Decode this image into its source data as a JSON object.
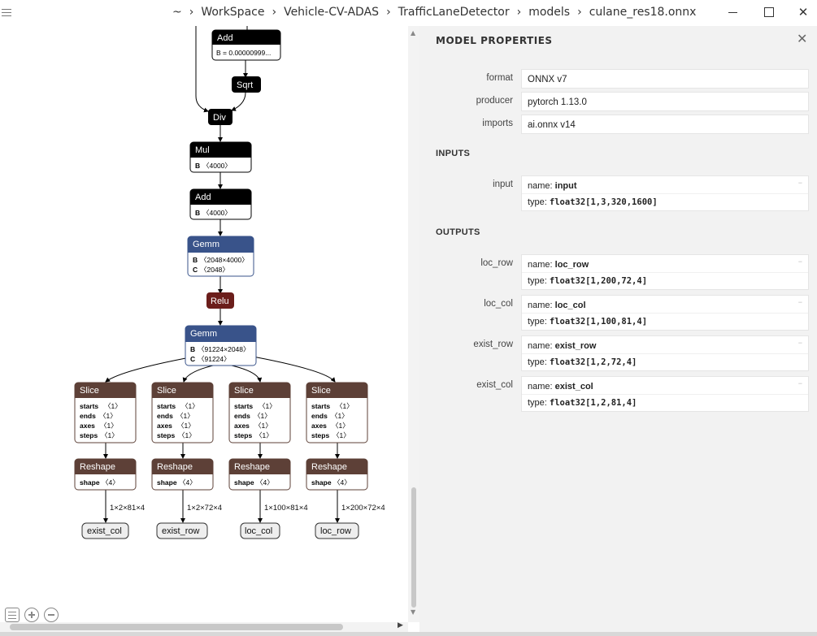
{
  "breadcrumb": [
    "~",
    "WorkSpace",
    "Vehicle-CV-ADAS",
    "TrafficLaneDetector",
    "models",
    "culane_res18.onnx"
  ],
  "window": {
    "minimize": "—",
    "maximize": "☐",
    "close": "✕"
  },
  "graph": {
    "nodes": {
      "add_top": {
        "op": "Add",
        "attr_label": "B = 0.00000999..."
      },
      "sqrt": {
        "op": "Sqrt"
      },
      "div": {
        "op": "Div"
      },
      "mul": {
        "op": "Mul",
        "attr_key": "B",
        "attr_val": "〈4000〉"
      },
      "add2": {
        "op": "Add",
        "attr_key": "B",
        "attr_val": "〈4000〉"
      },
      "gemm1": {
        "op": "Gemm",
        "b_key": "B",
        "b_val": "〈2048×4000〉",
        "c_key": "C",
        "c_val": "〈2048〉"
      },
      "relu": {
        "op": "Relu"
      },
      "gemm2": {
        "op": "Gemm",
        "b_key": "B",
        "b_val": "〈91224×2048〉",
        "c_key": "C",
        "c_val": "〈91224〉"
      }
    },
    "slice": {
      "op": "Slice",
      "keys": [
        "starts",
        "ends",
        "axes",
        "steps"
      ],
      "val": "〈1〉"
    },
    "reshape": {
      "op": "Reshape",
      "key": "shape",
      "val": "〈4〉"
    },
    "branches": [
      {
        "shape": "1×2×81×4",
        "output": "exist_col"
      },
      {
        "shape": "1×2×72×4",
        "output": "exist_row"
      },
      {
        "shape": "1×100×81×4",
        "output": "loc_col"
      },
      {
        "shape": "1×200×72×4",
        "output": "loc_row"
      }
    ]
  },
  "panel": {
    "title": "MODEL PROPERTIES",
    "close": "✕",
    "properties": [
      {
        "label": "format",
        "value": "ONNX v7"
      },
      {
        "label": "producer",
        "value": "pytorch 1.13.0"
      },
      {
        "label": "imports",
        "value": "ai.onnx v14"
      }
    ],
    "inputs_title": "INPUTS",
    "inputs": [
      {
        "label": "input",
        "name": "input",
        "type": "float32[1,3,320,1600]"
      }
    ],
    "outputs_title": "OUTPUTS",
    "outputs": [
      {
        "label": "loc_row",
        "name": "loc_row",
        "type": "float32[1,200,72,4]"
      },
      {
        "label": "loc_col",
        "name": "loc_col",
        "type": "float32[1,100,81,4]"
      },
      {
        "label": "exist_row",
        "name": "exist_row",
        "type": "float32[1,2,72,4]"
      },
      {
        "label": "exist_col",
        "name": "exist_col",
        "type": "float32[1,2,81,4]"
      }
    ],
    "name_prefix": "name: ",
    "type_prefix": "type: "
  },
  "colors": {
    "op_black": "#000000",
    "op_blue": "#39538a",
    "op_red": "#6b1e1b",
    "op_brown": "#5d4037",
    "panel_bg": "#f2f2f2"
  }
}
